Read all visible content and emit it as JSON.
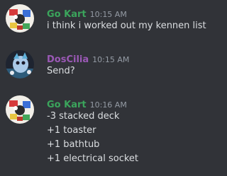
{
  "messages": [
    {
      "username": "Go Kart",
      "username_color": "#3ba55c",
      "timestamp": "10:15 AM",
      "avatar_icon": "go-kart-avatar-icon",
      "lines": [
        "i think i worked out my kennen list"
      ]
    },
    {
      "username": "DosCilia",
      "username_color": "#9b59b6",
      "timestamp": "10:15 AM",
      "avatar_icon": "doscilia-avatar-icon",
      "lines": [
        "Send?"
      ]
    },
    {
      "username": "Go Kart",
      "username_color": "#3ba55c",
      "timestamp": "10:16 AM",
      "avatar_icon": "go-kart-avatar-icon",
      "lines": [
        "-3 stacked deck",
        "+1 toaster",
        "+1 bathtub",
        "+1 electrical socket"
      ]
    }
  ]
}
